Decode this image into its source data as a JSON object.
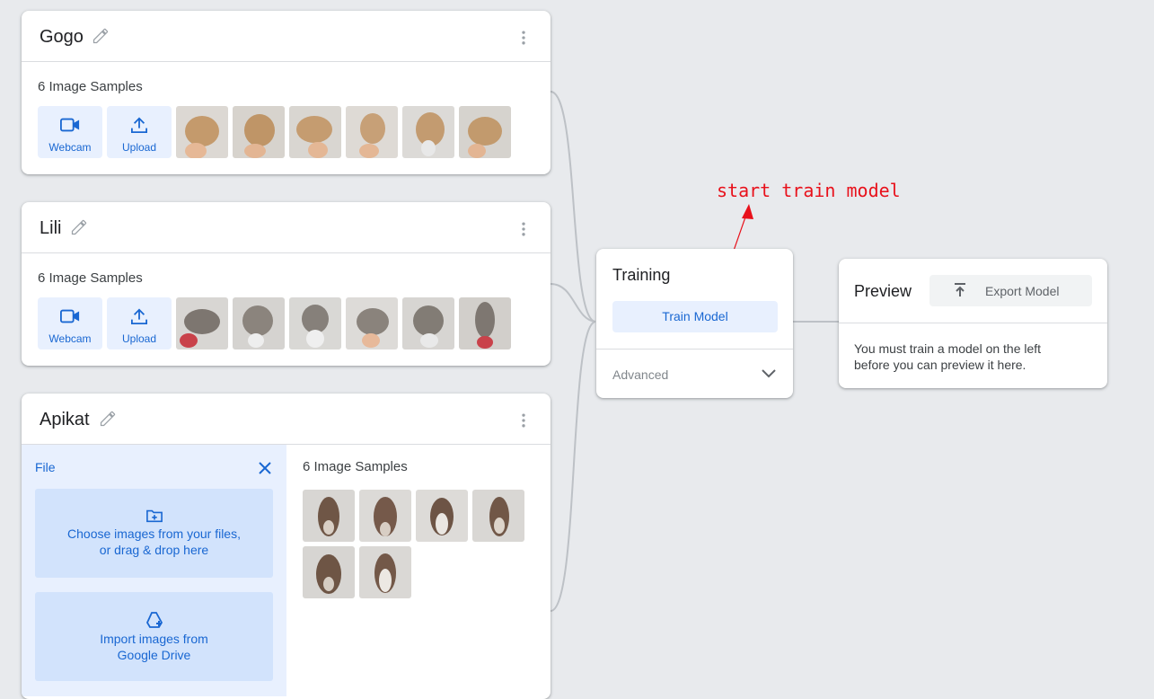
{
  "classes": [
    {
      "name": "Gogo",
      "samples": "6 Image Samples",
      "webcam_label": "Webcam",
      "upload_label": "Upload",
      "thumb_color": "#c9a57b"
    },
    {
      "name": "Lili",
      "samples": "6 Image Samples",
      "webcam_label": "Webcam",
      "upload_label": "Upload",
      "thumb_color": "#8a8580"
    },
    {
      "name": "Apikat",
      "samples": "6 Image Samples",
      "thumb_color": "#7a5e4c"
    }
  ],
  "upload_panel": {
    "file_label": "File",
    "choose_line1": "Choose images from your files,",
    "choose_line2": "or drag & drop here",
    "drive_line1": "Import images from",
    "drive_line2": "Google Drive"
  },
  "training": {
    "title": "Training",
    "train_button": "Train Model",
    "advanced": "Advanced"
  },
  "preview": {
    "title": "Preview",
    "export_button": "Export Model",
    "message": "You must train a model on the left before you can preview it here."
  },
  "annotation": "start train model",
  "colors": {
    "accent": "#1967d2",
    "accent_bg": "#e8f0fe",
    "annotation": "#e8111b"
  }
}
